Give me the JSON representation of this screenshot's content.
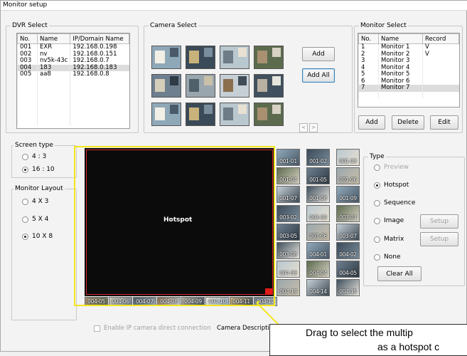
{
  "window": {
    "title": "Monitor setup"
  },
  "dvr_select": {
    "title": "DVR Select",
    "columns": [
      "No.",
      "Name",
      "IP/Domain Name"
    ],
    "rows": [
      [
        "001",
        "EXR",
        "192.168.0.198"
      ],
      [
        "002",
        "nv",
        "192.168.0.151"
      ],
      [
        "003",
        "nv5k-43c",
        "192.168.0.7"
      ],
      [
        "004",
        "183",
        "192.168.0.183"
      ],
      [
        "005",
        "aa8",
        "192.168.0.8"
      ]
    ],
    "selected_row": 3
  },
  "camera_select": {
    "title": "Camera Select",
    "add_label": "Add",
    "add_all_label": "Add All",
    "prev_label": "<",
    "next_label": ">"
  },
  "monitor_select": {
    "title": "Monitor Select",
    "columns": [
      "No.",
      "Name",
      "Record"
    ],
    "rows": [
      [
        "1",
        "Monitor 1",
        "V"
      ],
      [
        "2",
        "Monitor 2",
        "V"
      ],
      [
        "3",
        "Monitor 3",
        ""
      ],
      [
        "4",
        "Monitor 4",
        ""
      ],
      [
        "5",
        "Monitor 5",
        ""
      ],
      [
        "6",
        "Monitor 6",
        ""
      ],
      [
        "7",
        "Monitor 7",
        ""
      ]
    ],
    "selected_row": 6,
    "add_label": "Add",
    "delete_label": "Delete",
    "edit_label": "Edit"
  },
  "screen_type": {
    "title": "Screen type",
    "options": [
      "4 : 3",
      "16 : 10"
    ],
    "selected": "16 : 10"
  },
  "monitor_layout": {
    "title": "Monitor Layout",
    "options": [
      "4 X 3",
      "5 X 4",
      "10 X 8"
    ],
    "selected": "10 X 8"
  },
  "preview": {
    "hotspot_label": "Hotspot",
    "tiles_right": [
      [
        "001-01",
        "001-02",
        "001-03"
      ],
      [
        "001-04",
        "001-05",
        "001-06"
      ],
      [
        "001-07",
        "001-08",
        "001-09"
      ],
      [
        "003-02",
        "003-03",
        "003-04"
      ],
      [
        "003-05",
        "003-06",
        "003-07"
      ],
      [
        "003-08",
        "004-01",
        "004-02"
      ],
      [
        "004-03",
        "004-04",
        "004-05"
      ],
      [
        "004-13",
        "004-14",
        "004-15"
      ]
    ],
    "tiles_bottom": [
      "004-05",
      "004-06",
      "004-07",
      "004-08",
      "004-09",
      "004-10",
      "004-11",
      "004-12"
    ]
  },
  "type_panel": {
    "title": "Type",
    "options": [
      "Preview",
      "Hotspot",
      "Sequence",
      "Image",
      "Matrix",
      "None"
    ],
    "selected": "Hotspot",
    "disabled": [
      "Preview"
    ],
    "setup_label": "Setup",
    "clear_all_label": "Clear All"
  },
  "footer": {
    "enable_ip_label": "Enable IP camera direct connection",
    "camera_description_label": "Camera Description"
  },
  "callout": {
    "line1": "Drag to select the multip",
    "line2": "as a hotspot c"
  },
  "colors": {
    "selection_yellow": "#f3e61d",
    "hotspot_red": "#d9262c",
    "preview_black": "#0b0b0b"
  }
}
